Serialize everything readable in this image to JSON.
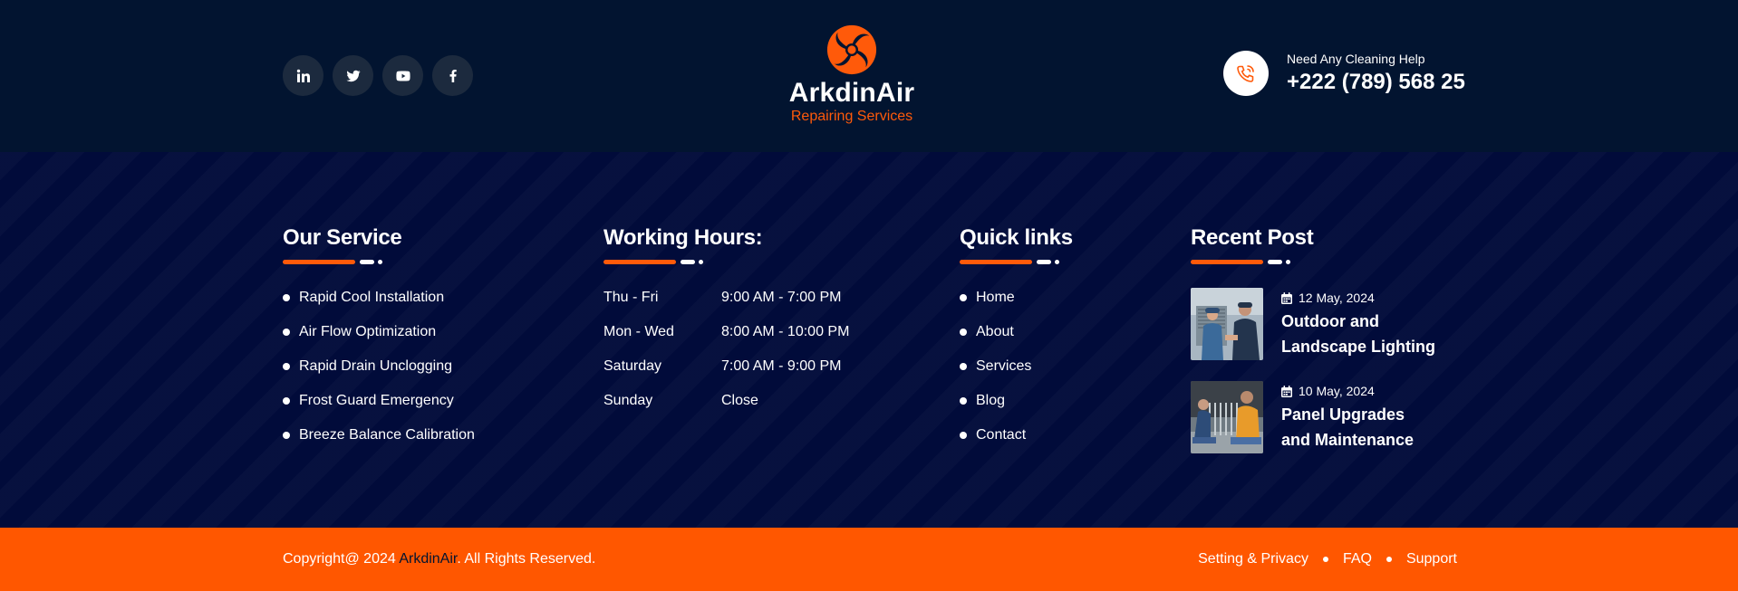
{
  "header": {
    "socials": [
      {
        "icon": "linkedin-icon"
      },
      {
        "icon": "twitter-icon"
      },
      {
        "icon": "youtube-icon"
      },
      {
        "icon": "facebook-icon"
      }
    ],
    "brand_name": "ArkdinAir",
    "brand_tagline": "Repairing Services",
    "help_label": "Need Any Cleaning Help",
    "help_phone": "+222 (789) 568 25"
  },
  "services": {
    "title": "Our Service",
    "items": [
      "Rapid Cool Installation",
      "Air Flow Optimization",
      "Rapid Drain Unclogging",
      "Frost Guard Emergency",
      "Breeze Balance Calibration"
    ]
  },
  "hours": {
    "title": "Working Hours:",
    "rows": [
      {
        "day": "Thu - Fri",
        "time": "9:00 AM - 7:00 PM"
      },
      {
        "day": "Mon - Wed",
        "time": "8:00 AM - 10:00 PM"
      },
      {
        "day": "Saturday",
        "time": "7:00 AM - 9:00 PM"
      },
      {
        "day": "Sunday",
        "time": "Close"
      }
    ]
  },
  "quick_links": {
    "title": "Quick links",
    "items": [
      "Home",
      "About",
      "Services",
      "Blog",
      "Contact"
    ]
  },
  "recent_posts": {
    "title": "Recent Post",
    "posts": [
      {
        "date": "12 May, 2024",
        "title": "Outdoor and Landscape Lighting"
      },
      {
        "date": "10 May, 2024",
        "title": "Panel Upgrades and Maintenance"
      }
    ]
  },
  "footer": {
    "copy_prefix": "Copyright@ 2024",
    "copy_brand": "ArkdinAir",
    "copy_suffix": ". All Rights Reserved.",
    "links": [
      "Setting & Privacy",
      "FAQ",
      "Support"
    ]
  },
  "colors": {
    "accent": "#ff5700",
    "topbar": "#021430",
    "main_bg": "#010b3a"
  }
}
